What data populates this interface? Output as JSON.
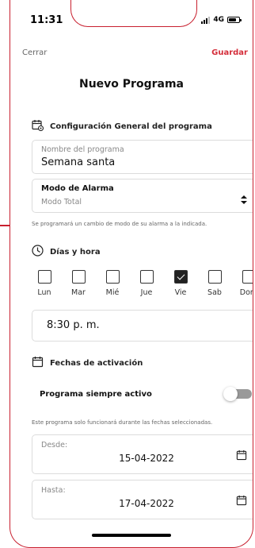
{
  "status_bar": {
    "time": "11:31",
    "network": "4G"
  },
  "nav": {
    "cancel_label": "Cerrar",
    "save_label": "Guardar"
  },
  "title": "Nuevo Programa",
  "general": {
    "section_title": "Configuración General del programa",
    "name_label": "Nombre del programa",
    "name_value": "Semana santa",
    "alarm_label": "Modo de Alarma",
    "alarm_value": "Modo Total",
    "alarm_helper": "Se programará un cambio de modo de su alarma a la indicada."
  },
  "schedule": {
    "section_title": "Días y hora",
    "days": [
      {
        "label": "Lun",
        "checked": false
      },
      {
        "label": "Mar",
        "checked": false
      },
      {
        "label": "Mié",
        "checked": false
      },
      {
        "label": "Jue",
        "checked": false
      },
      {
        "label": "Vie",
        "checked": true
      },
      {
        "label": "Sab",
        "checked": false
      },
      {
        "label": "Dom",
        "checked": false
      }
    ],
    "time_value": "8:30 p. m."
  },
  "activation": {
    "section_title": "Fechas de activación",
    "always_active_label": "Programa siempre activo",
    "always_active_on": false,
    "helper": "Este programa solo funcionará durante las fechas seleccionadas.",
    "from_label": "Desde:",
    "from_value": "15-04-2022",
    "to_label": "Hasta:",
    "to_value": "17-04-2022"
  },
  "colors": {
    "accent": "#d42d3a",
    "frame": "#c8202f",
    "checked_box": "#222222"
  }
}
